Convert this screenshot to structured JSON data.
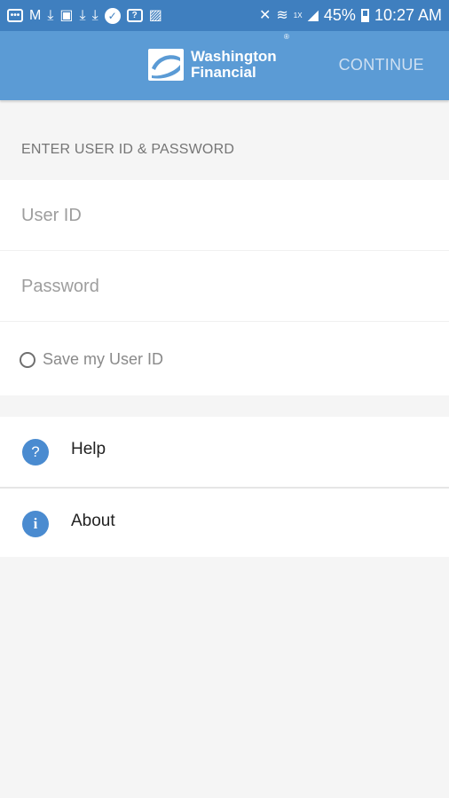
{
  "status_bar": {
    "network_badge": "1X",
    "battery": "45%",
    "time": "10:27 AM"
  },
  "app_bar": {
    "logo_line1": "Washington",
    "logo_line2": "Financial",
    "logo_tm": "®",
    "continue_label": "CONTINUE"
  },
  "login": {
    "section_title": "ENTER USER ID & PASSWORD",
    "user_id_placeholder": "User ID",
    "password_placeholder": "Password",
    "save_label": "Save my User ID"
  },
  "menu": {
    "items": [
      {
        "label": "Help",
        "icon": "help-icon",
        "glyph": "?"
      },
      {
        "label": "About",
        "icon": "info-icon",
        "glyph": "i"
      }
    ]
  },
  "colors": {
    "status_bar": "#3f7fbf",
    "app_bar": "#5b9bd5",
    "accent_icon": "#4a8bd0"
  }
}
